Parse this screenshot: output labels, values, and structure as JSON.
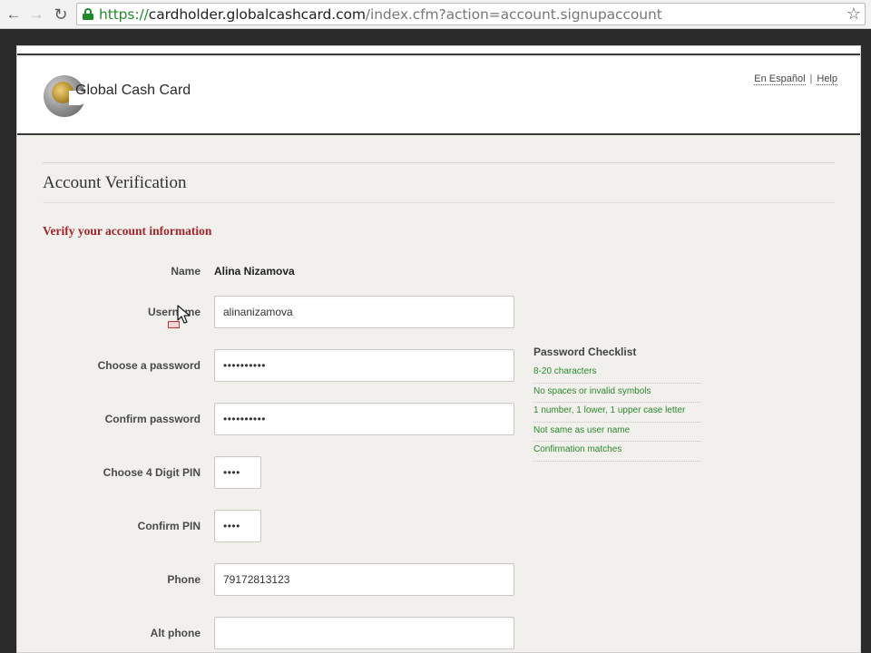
{
  "browser": {
    "url_scheme": "https://",
    "url_host": "cardholder.globalcashcard.com",
    "url_path": "/index.cfm?action=account.signupaccount",
    "icons": {
      "back": "back-arrow-icon",
      "forward": "forward-arrow-icon",
      "reload": "reload-icon",
      "lock": "lock-icon",
      "star": "star-icon"
    }
  },
  "header": {
    "brand": "Global Cash Card",
    "links": {
      "spanish": "En Español",
      "separator": "|",
      "help": "Help"
    }
  },
  "main": {
    "title": "Account Verification",
    "subtitle": "Verify your account information"
  },
  "form": {
    "name": {
      "label": "Name",
      "value": "Alina Nizamova"
    },
    "username": {
      "label": "Username",
      "value": "alinanizamova"
    },
    "password": {
      "label": "Choose a password",
      "value": "••••••••••"
    },
    "confirm_password": {
      "label": "Confirm password",
      "value": "••••••••••"
    },
    "pin": {
      "label": "Choose 4 Digit PIN",
      "value": "••••"
    },
    "confirm_pin": {
      "label": "Confirm PIN",
      "value": "••••"
    },
    "phone": {
      "label": "Phone",
      "value": "79172813123"
    },
    "alt_phone": {
      "label": "Alt phone",
      "value": ""
    }
  },
  "password_checklist": {
    "title": "Password Checklist",
    "items": [
      "8-20 characters",
      "No spaces or invalid symbols",
      "1 number, 1 lower, 1 upper case letter",
      "Not same as user name",
      "Confirmation matches"
    ]
  },
  "colors": {
    "accent_red": "#a3262a",
    "check_green": "#2a8a2a",
    "page_bg": "#f1f0ed"
  }
}
